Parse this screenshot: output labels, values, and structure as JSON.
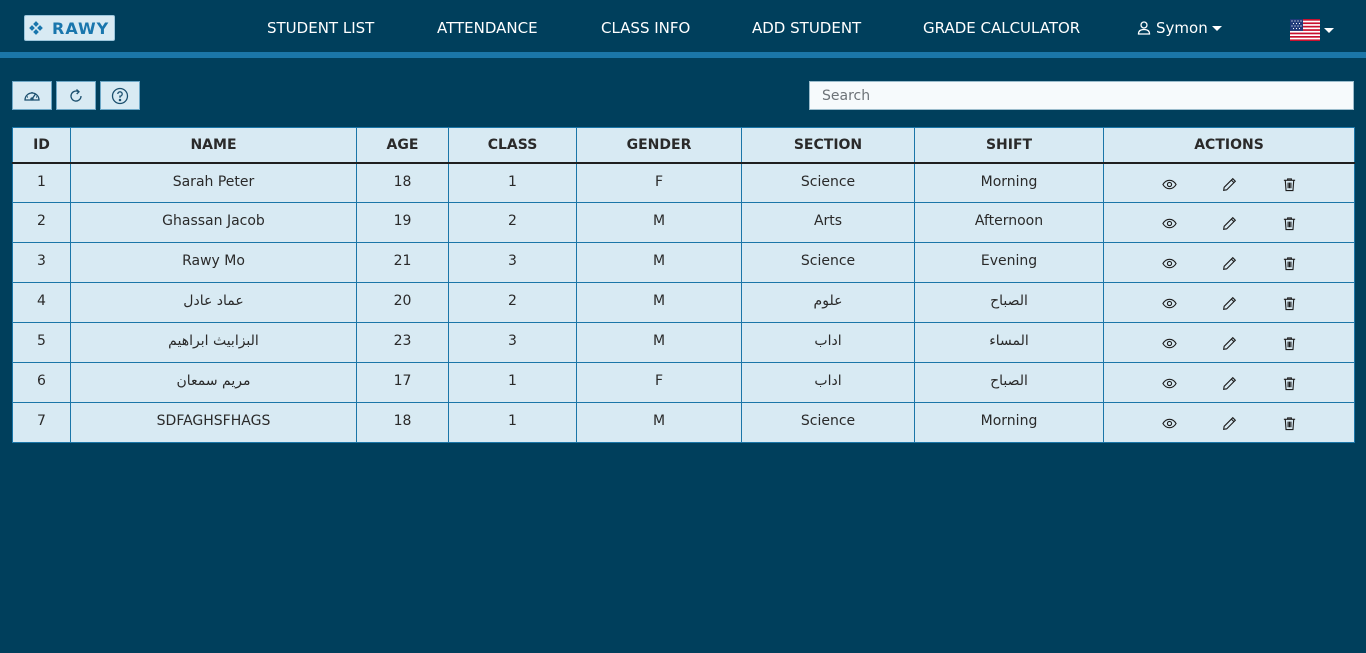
{
  "brand": {
    "name": "RAWY"
  },
  "nav": {
    "links": [
      "STUDENT LIST",
      "ATTENDANCE",
      "CLASS INFO",
      "ADD STUDENT",
      "GRADE CALCULATOR"
    ],
    "user": "Symon",
    "language_icon": "us-flag-icon"
  },
  "toolbar": {
    "buttons": [
      {
        "icon": "speedometer-icon"
      },
      {
        "icon": "refresh-icon"
      },
      {
        "icon": "help-icon"
      }
    ],
    "search_placeholder": "Search"
  },
  "table": {
    "headers": [
      "ID",
      "NAME",
      "AGE",
      "CLASS",
      "GENDER",
      "SECTION",
      "SHIFT",
      "ACTIONS"
    ],
    "rows": [
      [
        "1",
        "Sarah Peter",
        "18",
        "1",
        "F",
        "Science",
        "Morning"
      ],
      [
        "2",
        "Ghassan Jacob",
        "19",
        "2",
        "M",
        "Arts",
        "Afternoon"
      ],
      [
        "3",
        "Rawy Mo",
        "21",
        "3",
        "M",
        "Science",
        "Evening"
      ],
      [
        "4",
        "عماد عادل",
        "20",
        "2",
        "M",
        "علوم",
        "الصباح"
      ],
      [
        "5",
        "البزابيث ابراهيم",
        "23",
        "3",
        "M",
        "اداب",
        "المساء"
      ],
      [
        "6",
        "مريم سمعان",
        "17",
        "1",
        "F",
        "اداب",
        "الصباح"
      ],
      [
        "7",
        "SDFAGHSFHAGS",
        "18",
        "1",
        "M",
        "Science",
        "Morning"
      ]
    ],
    "row_actions": [
      "view-icon",
      "edit-icon",
      "delete-icon"
    ]
  }
}
